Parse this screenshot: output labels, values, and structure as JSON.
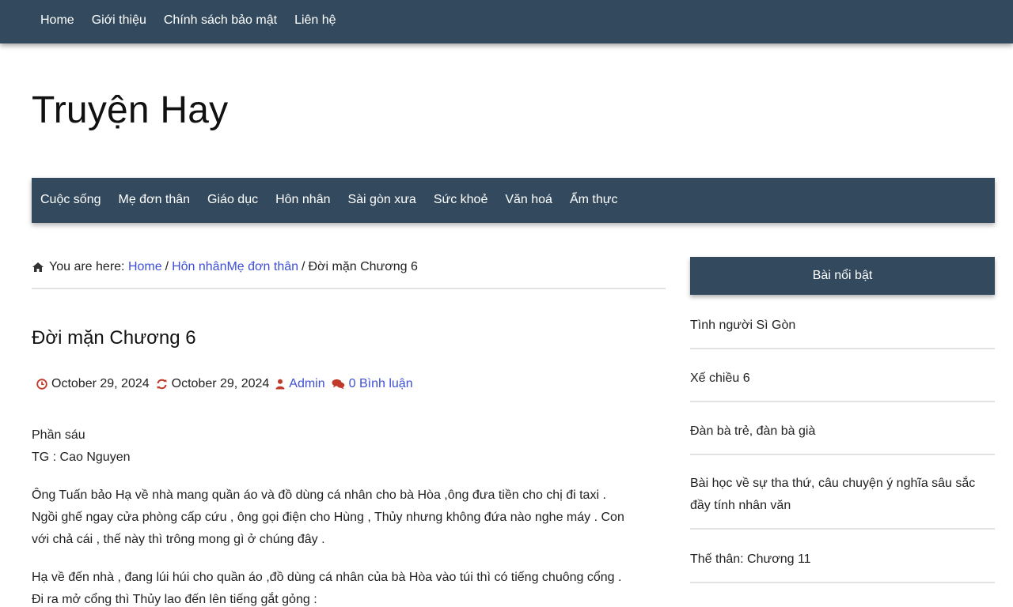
{
  "top_nav": {
    "items": [
      "Home",
      "Giới thiệu",
      "Chính sách bảo mật",
      "Liên hệ"
    ]
  },
  "site": {
    "title": "Truyện Hay"
  },
  "category_nav": {
    "items": [
      "Cuộc sống",
      "Mẹ đơn thân",
      "Giáo dục",
      "Hôn nhân",
      "Sài gòn xưa",
      "Sức khoẻ",
      "Văn hoá",
      "Ẩm thực"
    ]
  },
  "breadcrumb": {
    "prefix": "You are here:",
    "home": "Home",
    "sep1": "/",
    "cat1": "Hôn nhân",
    "cat2": "Mẹ đơn thân",
    "sep2": "/",
    "current": "Đời mặn Chương 6"
  },
  "post": {
    "title": "Đời mặn Chương 6",
    "published": "October 29, 2024",
    "updated": "October 29, 2024",
    "author": "Admin",
    "comments": "0 Bình luận",
    "paragraphs": [
      [
        "Phần sáu",
        "TG : Cao Nguyen"
      ],
      [
        "Ông Tuấn bảo Hạ về nhà mang quần áo và đồ dùng cá nhân cho bà Hòa ,ông đưa tiền cho chị đi taxi .",
        "Ngồi ghế ngay cửa phòng cấp cứu , ông gọi điện cho Hùng , Thủy nhưng không đứa nào nghe máy . Con",
        "với chả cái , thế này thì trông mong gì ở chúng đây ."
      ],
      [
        "Hạ về đến nhà , đang lúi húi cho quần áo ,đồ dùng cá nhân của bà Hòa vào túi thì có tiếng chuông cổng .",
        "Đi ra mở cổng thì Thủy lao đến lên tiếng gắt gỏng :"
      ]
    ]
  },
  "sidebar": {
    "heading": "Bài nổi bật",
    "items": [
      "Tình người Sì Gòn",
      "Xế chiều 6",
      "Đàn bà trẻ, đàn bà già",
      "Bài học về sự tha thứ, câu chuyện ý nghĩa sâu sắc đầy tính nhân văn",
      "Thế thân: Chương 11"
    ]
  },
  "colors": {
    "nav_bg": "#334a5e",
    "link": "#3d4fd6",
    "meta_icon": "#c0392b"
  },
  "icons": {
    "breadcrumb": "home-icon",
    "published": "clock-icon",
    "updated": "refresh-icon",
    "author": "user-icon",
    "comments": "comments-icon"
  }
}
